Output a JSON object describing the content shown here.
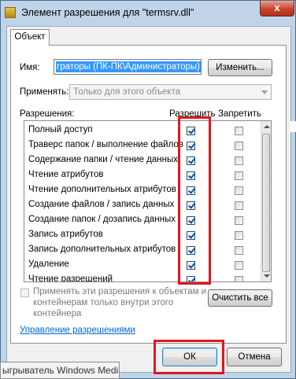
{
  "window": {
    "title": "Элемент разрешения для \"termsrv.dll\"",
    "close_glyph": "x"
  },
  "tabs": [
    {
      "label": "Объект"
    }
  ],
  "principal": {
    "label": "Имя:",
    "value": "граторы (ПК-ПК\\Администраторы)",
    "change_button": "Изменить..."
  },
  "apply_to": {
    "label": "Применять:",
    "value": "Только для этого объекта"
  },
  "permissions": {
    "header": "Разрешения:",
    "allow_header": "Разрешить",
    "deny_header": "Запретить",
    "rows": [
      {
        "label": "Полный доступ",
        "allow": true,
        "deny": false
      },
      {
        "label": "Траверс папок / выполнение файлов",
        "allow": true,
        "deny": false
      },
      {
        "label": "Содержание папки / чтение данных",
        "allow": true,
        "deny": false
      },
      {
        "label": "Чтение атрибутов",
        "allow": true,
        "deny": false
      },
      {
        "label": "Чтение дополнительных атрибутов",
        "allow": true,
        "deny": false
      },
      {
        "label": "Создание файлов / запись данных",
        "allow": true,
        "deny": false
      },
      {
        "label": "Создание папок / дозапись данных",
        "allow": true,
        "deny": false
      },
      {
        "label": "Запись атрибутов",
        "allow": true,
        "deny": false
      },
      {
        "label": "Запись дополнительных атрибутов",
        "allow": true,
        "deny": false
      },
      {
        "label": "Удаление",
        "allow": true,
        "deny": false
      },
      {
        "label": "Чтение разрешений",
        "allow": true,
        "deny": false
      }
    ]
  },
  "apply_inherit": {
    "text_line1": "Применять эти разрешения к объектам и",
    "text_line2": "контейнерам только внутри этого",
    "text_line3": "контейнера",
    "checked": false
  },
  "clear_all_button": "Очистить все",
  "manage_link": "Управление разрешениями",
  "ok_button": "ОК",
  "cancel_button": "Отмена",
  "taskbar_tooltip": "ыгрыватель Windows Media",
  "colors": {
    "highlight": "#e0171f",
    "link": "#0066cc",
    "selection": "#3399ff"
  }
}
